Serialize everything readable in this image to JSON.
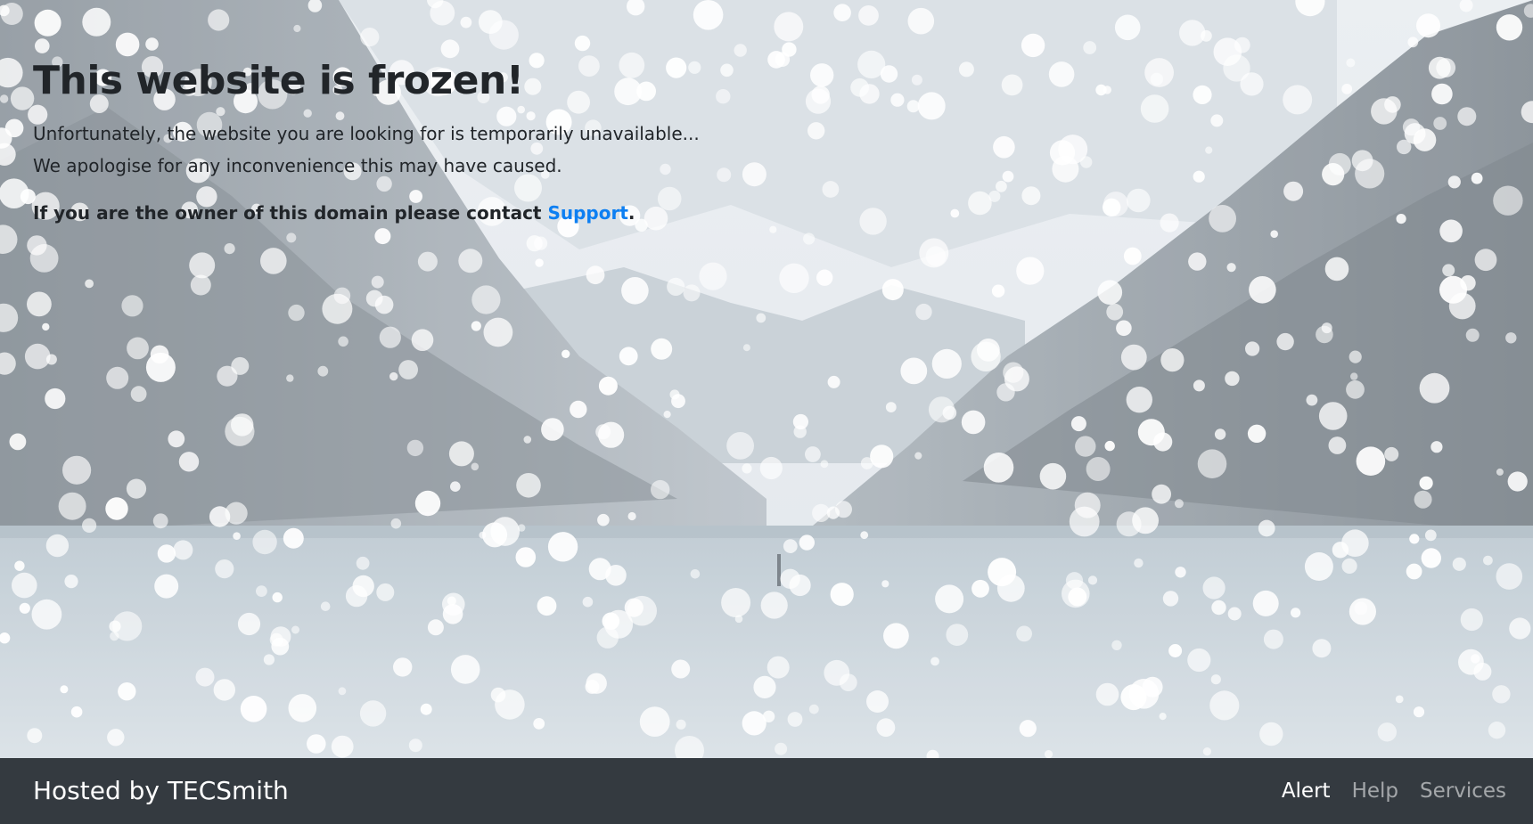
{
  "main": {
    "headline": "This website is frozen!",
    "lead_line_1": "Unfortunately, the website you are looking for is temporarily unavailable...",
    "lead_line_2": "We apologise for any inconvenience this may have caused.",
    "owner_prefix": "If you are the owner of this domain please contact ",
    "support_link": "Support",
    "owner_suffix": "."
  },
  "footer": {
    "brand": "Hosted by TECSmith",
    "nav": [
      {
        "label": "Alert",
        "active": true
      },
      {
        "label": "Help",
        "active": false
      },
      {
        "label": "Services",
        "active": false
      }
    ]
  },
  "colors": {
    "footer_bg": "#343a40",
    "link": "#0d7ff2",
    "text": "#212529"
  }
}
